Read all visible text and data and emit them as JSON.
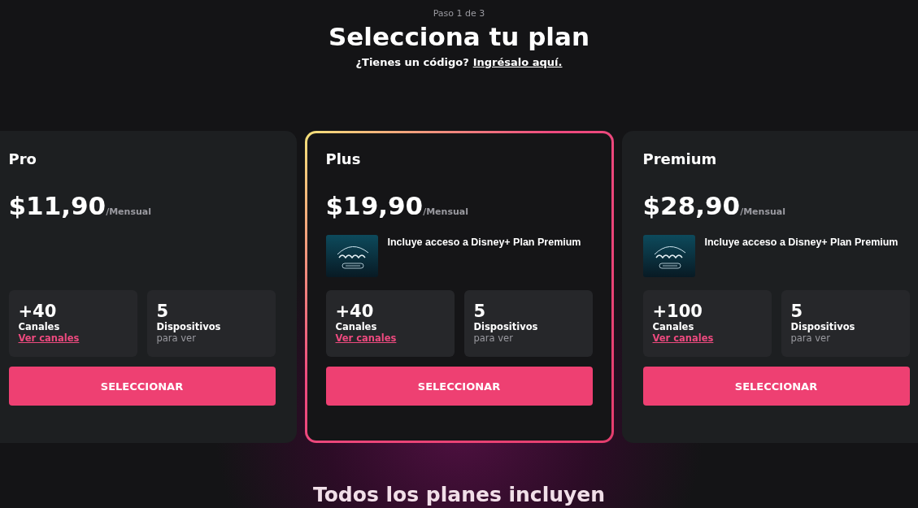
{
  "step": "Paso 1 de 3",
  "title": "Selecciona tu plan",
  "code_prompt": {
    "text": "¿Tienes un código?",
    "link": "Ingrésalo aquí."
  },
  "plans": [
    {
      "name": "Pro",
      "price": "$11,90",
      "period": "/Mensual",
      "selected": false,
      "channels": {
        "count": "+40",
        "label": "Canales",
        "link": "Ver canales"
      },
      "devices": {
        "count": "5",
        "label": "Dispositivos",
        "sub": "para ver"
      },
      "button": "SELECCIONAR"
    },
    {
      "name": "Plus",
      "price": "$19,90",
      "period": "/Mensual",
      "selected": true,
      "perk": {
        "kind": "picture",
        "text": "Incluye acceso a Disney+ Plan Premium"
      },
      "channels": {
        "count": "+40",
        "label": "Canales",
        "link": "Ver canales"
      },
      "devices": {
        "count": "5",
        "label": "Dispositivos",
        "sub": "para ver"
      },
      "button": "SELECCIONAR"
    },
    {
      "name": "Premium",
      "price": "$28,90",
      "period": "/Mensual",
      "selected": false,
      "perk": {
        "kind": "picture",
        "text": "Incluye acceso a Disney+ Plan Premium"
      },
      "channels": {
        "count": "+100",
        "label": "Canales",
        "link": "Ver canales"
      },
      "devices": {
        "count": "5",
        "label": "Dispositivos",
        "sub": "para ver"
      },
      "button": "SELECCIONAR"
    }
  ],
  "footer_heading": "Todos los planes incluyen"
}
